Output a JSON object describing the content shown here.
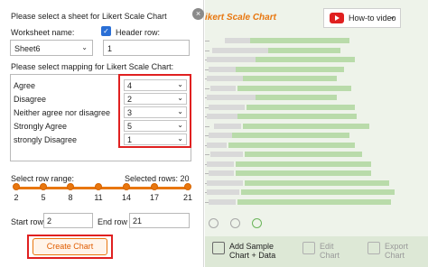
{
  "dialog": {
    "close_glyph": "×",
    "prompt": "Please select a sheet for Likert Scale Chart",
    "worksheet_label": "Worksheet name:",
    "header_row_label": "Header row:",
    "header_row_checked": true,
    "worksheet_value": "Sheet6",
    "header_row_value": "1",
    "mapping_prompt": "Please select mapping for Likert Scale Chart:",
    "mappings": [
      {
        "label": "Agree",
        "value": "4"
      },
      {
        "label": "Disagree",
        "value": "2"
      },
      {
        "label": "Neither agree nor disagree",
        "value": "3"
      },
      {
        "label": "Strongly Agree",
        "value": "5"
      },
      {
        "label": "strongly Disagree",
        "value": "1"
      }
    ],
    "row_range_label": "Select row range:",
    "selected_rows_text": "Selected rows: 20",
    "slider_ticks": [
      "2",
      "5",
      "8",
      "11",
      "14",
      "17",
      "21"
    ],
    "slider_range": [
      2,
      21
    ],
    "start_row_label": "Start row",
    "start_row_value": "2",
    "end_row_label": "End row",
    "end_row_value": "21",
    "create_button": "Create Chart"
  },
  "preview": {
    "title": "ikert Scale Chart",
    "howto_label": "How-to video",
    "actions": [
      {
        "line1": "Add Sample",
        "line2": "Chart + Data",
        "enabled": true
      },
      {
        "line1": "Edit",
        "line2": "Chart",
        "enabled": false
      },
      {
        "line1": "Export",
        "line2": "Chart",
        "enabled": false
      }
    ]
  },
  "colors": {
    "accent": "#e8760e",
    "highlight": "#e02020",
    "preview_bg": "#eef3ea",
    "bar_green": "#b9dbaa",
    "bar_gray": "#d9d9d9"
  }
}
